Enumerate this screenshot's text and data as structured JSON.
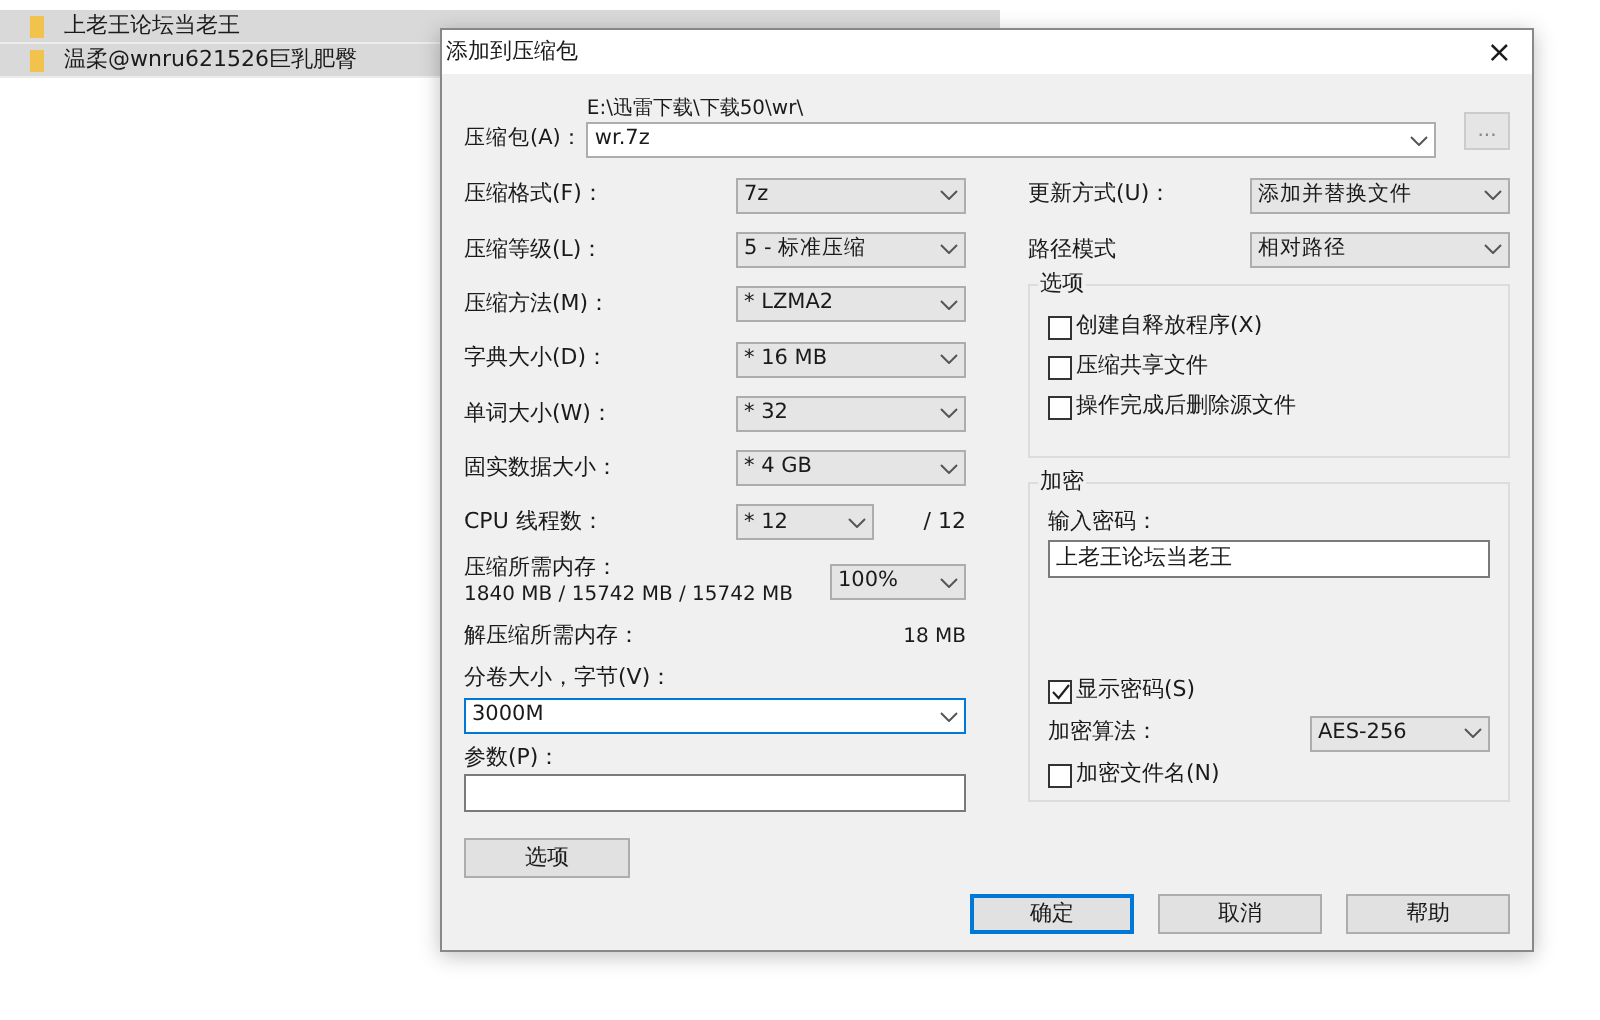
{
  "file_list": [
    {
      "name": "上老王论坛当老王"
    },
    {
      "name": "温柔@wnru621526巨乳肥臀"
    }
  ],
  "dialog": {
    "title": "添加到压缩包",
    "close": "×",
    "archive": {
      "label": "压缩包(A)：",
      "path": "E:\\迅雷下载\\下载50\\wr\\",
      "value": "wr.7z",
      "browse": "..."
    },
    "left_rows": [
      {
        "kind": "select",
        "label": "压缩格式(F)：",
        "value": "7z"
      },
      {
        "kind": "select",
        "label": "压缩等级(L)：",
        "value": "5 - 标准压缩"
      },
      {
        "kind": "select",
        "label": "压缩方法(M)：",
        "value": "* LZMA2"
      },
      {
        "kind": "select",
        "label": "字典大小(D)：",
        "value": "* 16 MB"
      },
      {
        "kind": "select",
        "label": "单词大小(W)：",
        "value": "* 32"
      },
      {
        "kind": "select",
        "label": "固实数据大小：",
        "value": "* 4 GB"
      },
      {
        "kind": "threads",
        "label": "CPU 线程数：",
        "value": "* 12",
        "suffix": "/ 12"
      },
      {
        "kind": "memory",
        "label": "压缩所需内存：",
        "detail": "1840 MB / 15742 MB / 15742 MB",
        "value": "100%"
      },
      {
        "kind": "info",
        "label": "解压缩所需内存：",
        "value": "18 MB"
      }
    ],
    "split": {
      "label": "分卷大小，字节(V)：",
      "value": "3000M",
      "focused": true
    },
    "parameters": {
      "label": "参数(P)："
    },
    "options_button": "选项",
    "right_rows": [
      {
        "label": "更新方式(U)：",
        "value": "添加并替换文件"
      },
      {
        "label": "路径模式",
        "value": "相对路径"
      }
    ],
    "options_group": {
      "title": "选项",
      "items": [
        {
          "label": "创建自释放程序(X)",
          "checked": false
        },
        {
          "label": "压缩共享文件",
          "checked": false
        },
        {
          "label": "操作完成后删除源文件",
          "checked": false
        }
      ]
    },
    "encryption": {
      "title": "加密",
      "password_label": "输入密码：",
      "password": "上老王论坛当老王",
      "show_password": {
        "label": "显示密码(S)",
        "checked": true
      },
      "method_label": "加密算法：",
      "method": "AES-256",
      "encrypt_names": {
        "label": "加密文件名(N)",
        "checked": false
      }
    },
    "buttons": [
      {
        "label": "确定",
        "default": true
      },
      {
        "label": "取消",
        "default": false
      },
      {
        "label": "帮助",
        "default": false
      }
    ]
  }
}
